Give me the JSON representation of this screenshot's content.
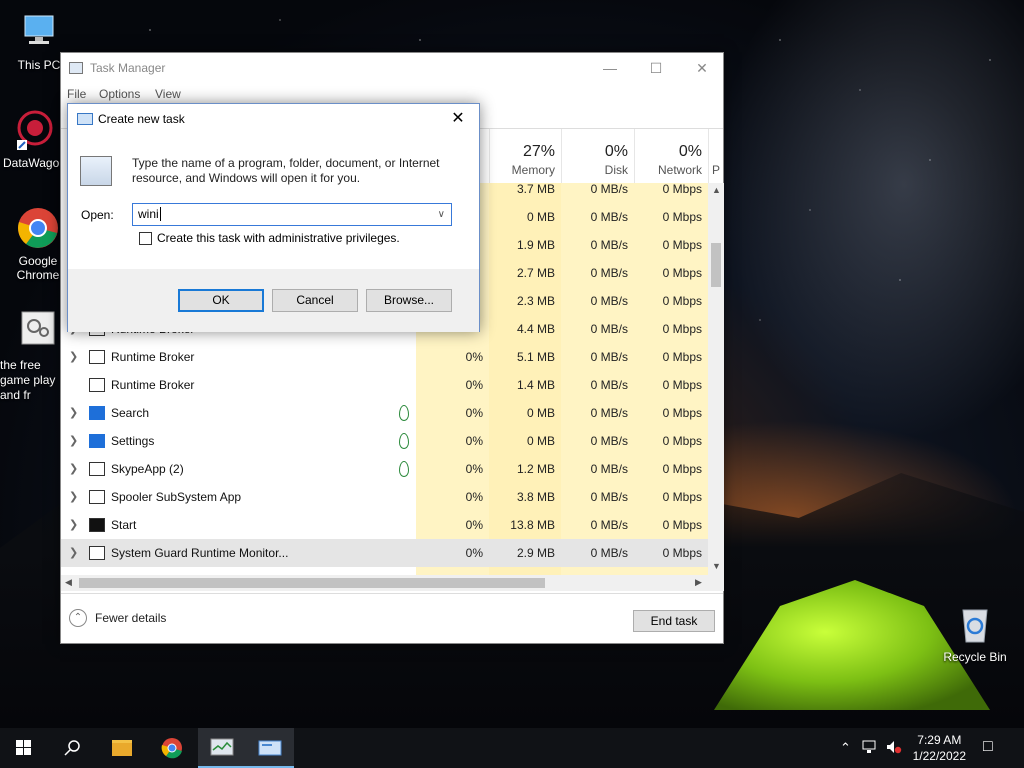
{
  "desktop": {
    "icons": [
      {
        "label": "This PC"
      },
      {
        "label": "DataWagon"
      },
      {
        "label": "Google Chrome"
      },
      {
        "label": "the free game play and fr"
      },
      {
        "label": "Recycle Bin"
      }
    ]
  },
  "task_manager": {
    "title": "Task Manager",
    "menu": [
      "File",
      "Options",
      "View"
    ],
    "columns": [
      {
        "pct": "27%",
        "label": "Memory"
      },
      {
        "pct": "0%",
        "label": "Disk"
      },
      {
        "pct": "0%",
        "label": "Network"
      },
      {
        "pct": "P",
        "label": ""
      }
    ],
    "rows": [
      {
        "name": "",
        "cpu": "",
        "mem": "3.7 MB",
        "disk": "0 MB/s",
        "net": "0 Mbps"
      },
      {
        "name": "",
        "cpu": "",
        "mem": "0 MB",
        "disk": "0 MB/s",
        "net": "0 Mbps"
      },
      {
        "name": "",
        "cpu": "",
        "mem": "1.9 MB",
        "disk": "0 MB/s",
        "net": "0 Mbps"
      },
      {
        "name": "",
        "cpu": "",
        "mem": "2.7 MB",
        "disk": "0 MB/s",
        "net": "0 Mbps"
      },
      {
        "name": "",
        "cpu": "",
        "mem": "2.3 MB",
        "disk": "0 MB/s",
        "net": "0 Mbps"
      },
      {
        "name": "Runtime Broker",
        "cpu": "",
        "mem": "4.4 MB",
        "disk": "0 MB/s",
        "net": "0 Mbps"
      },
      {
        "name": "Runtime Broker",
        "cpu": "0%",
        "mem": "5.1 MB",
        "disk": "0 MB/s",
        "net": "0 Mbps"
      },
      {
        "name": "Runtime Broker",
        "cpu": "0%",
        "mem": "1.4 MB",
        "disk": "0 MB/s",
        "net": "0 Mbps"
      },
      {
        "name": "Search",
        "cpu": "0%",
        "mem": "0 MB",
        "disk": "0 MB/s",
        "net": "0 Mbps"
      },
      {
        "name": "Settings",
        "cpu": "0%",
        "mem": "0 MB",
        "disk": "0 MB/s",
        "net": "0 Mbps"
      },
      {
        "name": "SkypeApp (2)",
        "cpu": "0%",
        "mem": "1.2 MB",
        "disk": "0 MB/s",
        "net": "0 Mbps"
      },
      {
        "name": "Spooler SubSystem App",
        "cpu": "0%",
        "mem": "3.8 MB",
        "disk": "0 MB/s",
        "net": "0 Mbps"
      },
      {
        "name": "Start",
        "cpu": "0%",
        "mem": "13.8 MB",
        "disk": "0 MB/s",
        "net": "0 Mbps"
      },
      {
        "name": "System Guard Runtime Monitor...",
        "cpu": "0%",
        "mem": "2.9 MB",
        "disk": "0 MB/s",
        "net": "0 Mbps"
      }
    ],
    "fewer_details": "Fewer details",
    "end_task": "End task"
  },
  "run_dialog": {
    "title": "Create new task",
    "description": "Type the name of a program, folder, document, or Internet resource, and Windows will open it for you.",
    "open_label": "Open:",
    "open_value": "wini",
    "admin_checkbox": "Create this task with administrative privileges.",
    "ok": "OK",
    "cancel": "Cancel",
    "browse": "Browse..."
  },
  "taskbar": {
    "time": "7:29 AM",
    "date": "1/22/2022"
  }
}
